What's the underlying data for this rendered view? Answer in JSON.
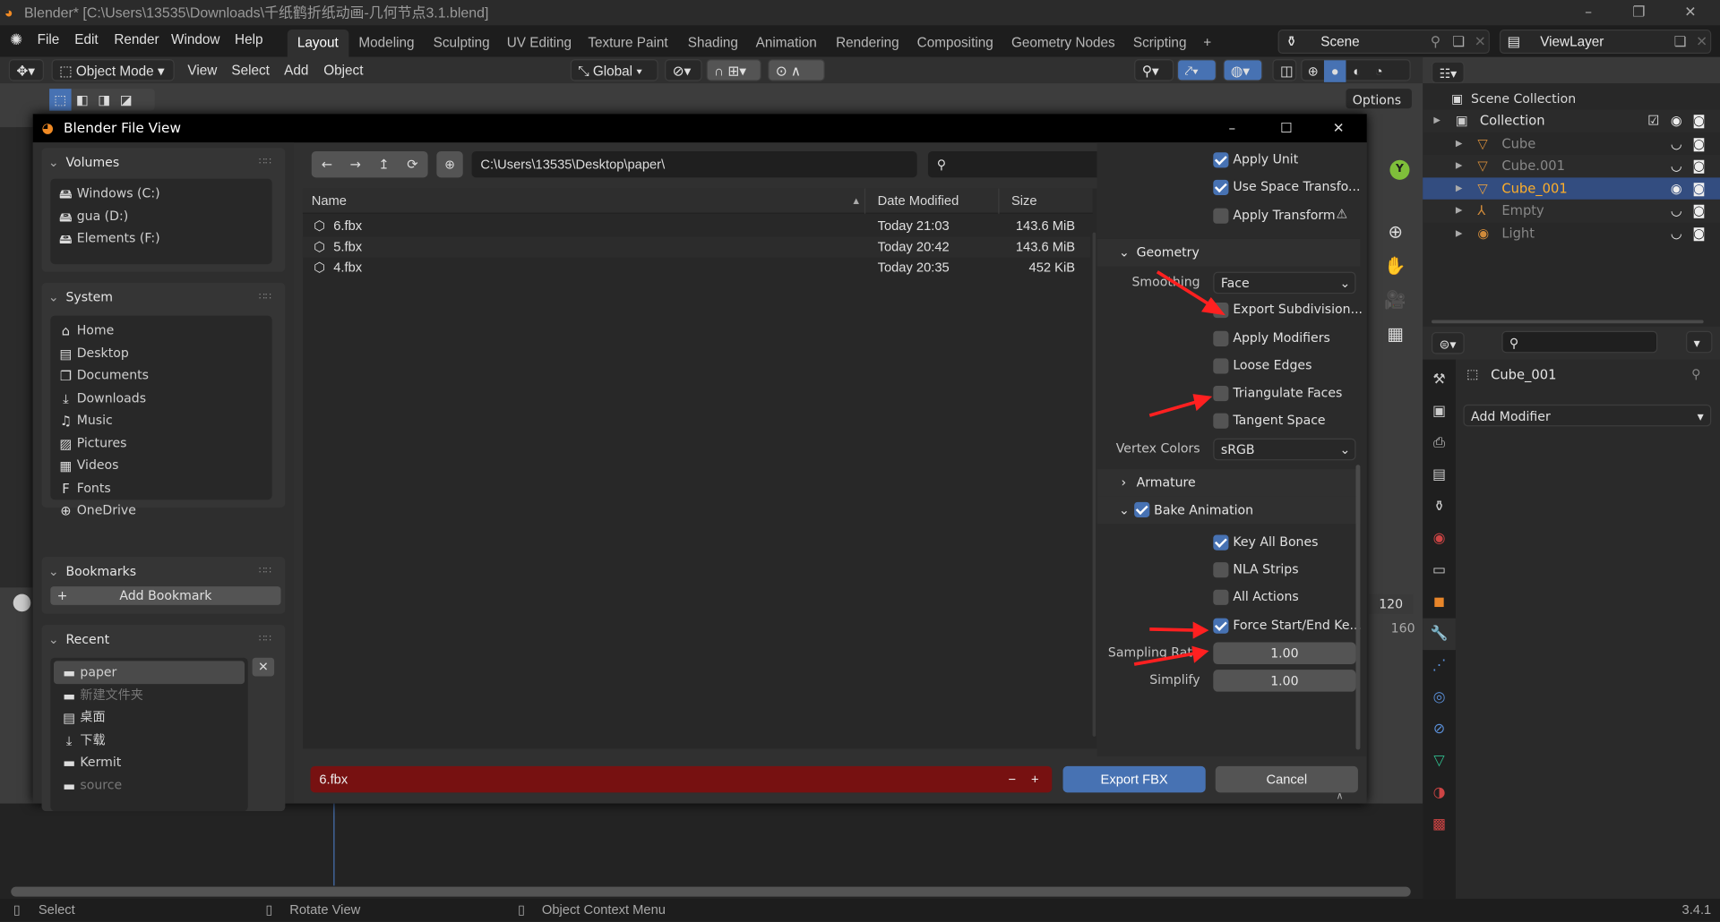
{
  "window": {
    "title": "Blender* [C:\\Users\\13535\\Downloads\\千纸鹤折纸动画-几何节点3.1.blend]",
    "minimize": "–",
    "restore": "❐",
    "close": "✕"
  },
  "menubar": {
    "items": [
      "File",
      "Edit",
      "Render",
      "Window",
      "Help"
    ],
    "workspaces": [
      "Layout",
      "Modeling",
      "Sculpting",
      "UV Editing",
      "Texture Paint",
      "Shading",
      "Animation",
      "Rendering",
      "Compositing",
      "Geometry Nodes",
      "Scripting",
      "+"
    ],
    "active_workspace": "Layout",
    "scene": "Scene",
    "view_layer": "ViewLayer"
  },
  "header": {
    "mode": "Object Mode",
    "menus": [
      "View",
      "Select",
      "Add",
      "Object"
    ],
    "orientation": "Global",
    "options": "Options"
  },
  "outliner": {
    "root": "Scene Collection",
    "items": [
      {
        "name": "Collection",
        "level": 0,
        "selected": false
      },
      {
        "name": "Cube",
        "level": 1,
        "selected": false
      },
      {
        "name": "Cube.001",
        "level": 1,
        "selected": false
      },
      {
        "name": "Cube_001",
        "level": 1,
        "selected": true
      },
      {
        "name": "Empty",
        "level": 1,
        "selected": false
      },
      {
        "name": "Light",
        "level": 1,
        "selected": false
      }
    ]
  },
  "properties": {
    "object_name": "Cube_001",
    "add_modifier": "Add Modifier"
  },
  "timeline": {
    "end_frame": "120",
    "ruler_mark": "160"
  },
  "dialog": {
    "title": "Blender File View",
    "minimize": "–",
    "maximize": "☐",
    "close": "✕",
    "sidebar": {
      "volumes": {
        "title": "Volumes",
        "items": [
          "Windows (C:)",
          "gua (D:)",
          "Elements (F:)"
        ]
      },
      "system": {
        "title": "System",
        "items": [
          "Home",
          "Desktop",
          "Documents",
          "Downloads",
          "Music",
          "Pictures",
          "Videos",
          "Fonts",
          "OneDrive"
        ]
      },
      "bookmarks": {
        "title": "Bookmarks",
        "add": "Add Bookmark"
      },
      "recent": {
        "title": "Recent",
        "items": [
          {
            "name": "paper",
            "muted": false,
            "active": true
          },
          {
            "name": "新建文件夹",
            "muted": true
          },
          {
            "name": "桌面",
            "muted": false
          },
          {
            "name": "下载",
            "muted": false
          },
          {
            "name": "Kermit",
            "muted": false
          },
          {
            "name": "source",
            "muted": true
          }
        ]
      }
    },
    "path": "C:\\Users\\13535\\Desktop\\paper\\",
    "search_placeholder": "",
    "columns": {
      "name": "Name",
      "date": "Date Modified",
      "size": "Size"
    },
    "files": [
      {
        "name": "6.fbx",
        "date": "Today 21:03",
        "size": "143.6 MiB"
      },
      {
        "name": "5.fbx",
        "date": "Today 20:42",
        "size": "143.6 MiB"
      },
      {
        "name": "4.fbx",
        "date": "Today 20:35",
        "size": "452 KiB"
      }
    ],
    "settings": {
      "transform_checks": [
        {
          "label": "Apply Unit",
          "checked": true
        },
        {
          "label": "Use Space Transfo...",
          "checked": true
        },
        {
          "label": "Apply Transform",
          "checked": false,
          "warning": true
        }
      ],
      "geometry_title": "Geometry",
      "smoothing_label": "Smoothing",
      "smoothing_value": "Face",
      "geometry_checks": [
        {
          "label": "Export Subdivision...",
          "checked": false
        },
        {
          "label": "Apply Modifiers",
          "checked": false
        },
        {
          "label": "Loose Edges",
          "checked": false
        },
        {
          "label": "Triangulate Faces",
          "checked": false
        },
        {
          "label": "Tangent Space",
          "checked": false
        }
      ],
      "vertex_colors_label": "Vertex Colors",
      "vertex_colors_value": "sRGB",
      "armature_title": "Armature",
      "bake_title": "Bake Animation",
      "bake_checked": true,
      "bake_checks": [
        {
          "label": "Key All Bones",
          "checked": true
        },
        {
          "label": "NLA Strips",
          "checked": false
        },
        {
          "label": "All Actions",
          "checked": false
        },
        {
          "label": "Force Start/End Ke...",
          "checked": true
        }
      ],
      "sampling_label": "Sampling Rate",
      "sampling_value": "1.00",
      "simplify_label": "Simplify",
      "simplify_value": "1.00"
    },
    "filename": "6.fbx",
    "export_button": "Export FBX",
    "cancel_button": "Cancel",
    "filename_bg": "#771111"
  },
  "statusbar": {
    "items": [
      "Select",
      "Rotate View",
      "Object Context Menu"
    ],
    "version": "3.4.1"
  },
  "colors": {
    "accent": "#4772b3",
    "selected_object": "#ffaf29",
    "annotation": "#ff2020"
  }
}
